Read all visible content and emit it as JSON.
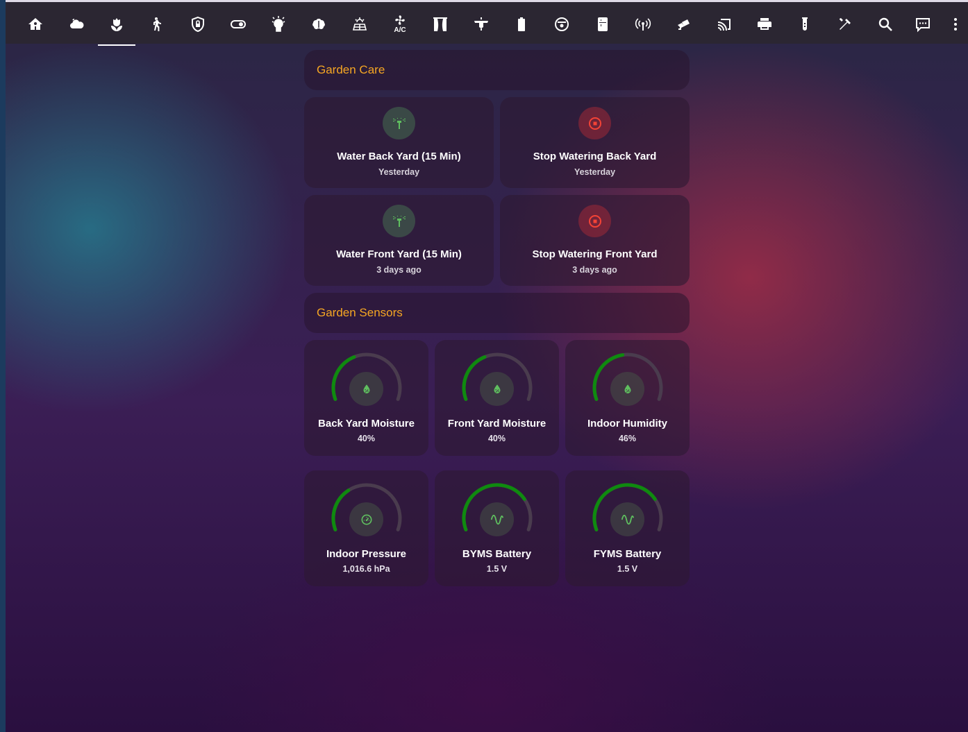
{
  "toolbar": {
    "tabs": [
      {
        "icon": "home-automation-icon"
      },
      {
        "icon": "weather-cloud-icon"
      },
      {
        "icon": "flower-icon",
        "active": true
      },
      {
        "icon": "motion-walk-icon"
      },
      {
        "icon": "shield-lock-icon"
      },
      {
        "icon": "toggle-switch-icon"
      },
      {
        "icon": "lightbulb-icon"
      },
      {
        "icon": "brain-icon"
      },
      {
        "icon": "solar-power-icon"
      },
      {
        "icon": "fan-ac-icon",
        "text": "A/C"
      },
      {
        "icon": "curtains-icon"
      },
      {
        "icon": "ceiling-fan-icon"
      },
      {
        "icon": "battery-icon"
      },
      {
        "icon": "robot-vacuum-icon"
      },
      {
        "icon": "fridge-icon"
      },
      {
        "icon": "access-point-icon"
      },
      {
        "icon": "cctv-camera-icon"
      },
      {
        "icon": "cast-icon"
      },
      {
        "icon": "printer-icon"
      },
      {
        "icon": "test-tube-icon"
      },
      {
        "icon": "tools-icon"
      },
      {
        "icon": "search-icon"
      },
      {
        "icon": "assist-chat-icon"
      },
      {
        "icon": "more-vertical-icon"
      }
    ]
  },
  "garden_care": {
    "title": "Garden Care",
    "buttons": [
      {
        "name": "Water Back Yard (15 Min)",
        "sub": "Yesterday",
        "icon": "sprinkler-icon",
        "color": "#5fbf5f"
      },
      {
        "name": "Stop Watering Back Yard",
        "sub": "Yesterday",
        "icon": "stop-circle-icon",
        "color": "#f44336"
      },
      {
        "name": "Water Front Yard (15 Min)",
        "sub": "3 days ago",
        "icon": "sprinkler-icon",
        "color": "#5fbf5f"
      },
      {
        "name": "Stop Watering Front Yard",
        "sub": "3 days ago",
        "icon": "stop-circle-icon",
        "color": "#f44336"
      }
    ]
  },
  "garden_sensors": {
    "title": "Garden Sensors",
    "gauges": [
      {
        "name": "Back Yard Moisture",
        "value": "40%",
        "level": 0.4,
        "icon": "water-percent-icon"
      },
      {
        "name": "Front Yard Moisture",
        "value": "40%",
        "level": 0.4,
        "icon": "water-percent-icon"
      },
      {
        "name": "Indoor Humidity",
        "value": "46%",
        "level": 0.46,
        "icon": "water-percent-icon"
      },
      {
        "name": "Indoor Pressure",
        "value": "1,016.6 hPa",
        "level": 0.35,
        "icon": "gauge-icon"
      },
      {
        "name": "BYMS Battery",
        "value": "1.5 V",
        "level": 0.75,
        "icon": "sine-wave-icon"
      },
      {
        "name": "FYMS Battery",
        "value": "1.5 V",
        "level": 0.75,
        "icon": "sine-wave-icon"
      }
    ]
  },
  "colors": {
    "accent": "#f5a623",
    "gauge_fill": "#0f8a0f",
    "gauge_track": "#4a3c4e",
    "icon_green": "#5fbf5f",
    "icon_red": "#f44336"
  }
}
